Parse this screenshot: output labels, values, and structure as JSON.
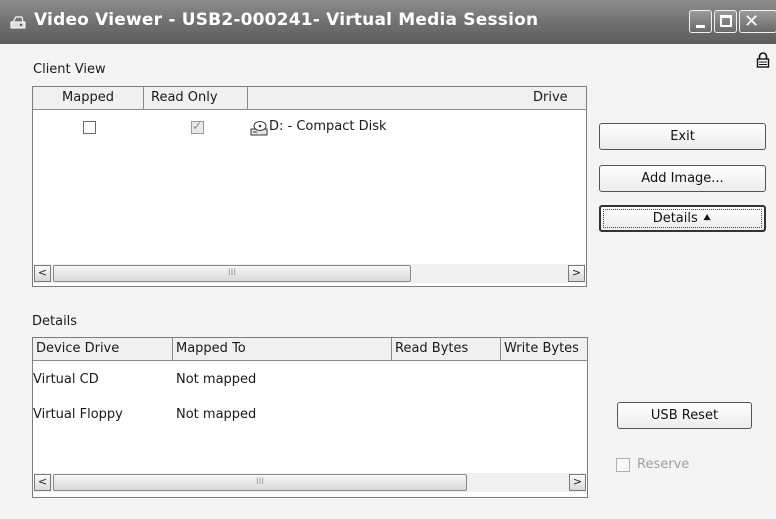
{
  "window": {
    "title": "Video Viewer - USB2-000241- Virtual Media Session",
    "icons": {
      "app": "drive-icon",
      "lock": "lock-icon",
      "minimize": "minimize-icon",
      "maximize": "maximize-icon",
      "close": "close-icon"
    },
    "close_glyph": "✕"
  },
  "client_view": {
    "section_label": "Client View",
    "columns": [
      "Mapped",
      "Read Only",
      "",
      "Drive"
    ],
    "rows": [
      {
        "mapped": false,
        "read_only": true,
        "drive_icon": "cd-drive-icon",
        "drive": "D: - Compact Disk"
      }
    ]
  },
  "details": {
    "section_label": "Details",
    "columns": [
      "Device Drive",
      "Mapped To",
      "Read Bytes",
      "Write Bytes"
    ],
    "rows": [
      {
        "device": "Virtual CD",
        "mapped_to": "Not mapped",
        "read": "",
        "write": ""
      },
      {
        "device": "Virtual Floppy",
        "mapped_to": "Not mapped",
        "read": "",
        "write": ""
      }
    ]
  },
  "buttons": {
    "exit": "Exit",
    "add_image": "Add Image...",
    "details": "Details ⯅",
    "usb_reset": "USB Reset"
  },
  "reserve": {
    "label": "Reserve",
    "checked": false,
    "enabled": false
  },
  "scroll_glyphs": {
    "left": "<",
    "right": ">",
    "grip": "III"
  },
  "colors": {
    "titlebar": "#6f6f6f",
    "background": "#f4f4f4",
    "disabled_text": "#a0a0a0"
  }
}
